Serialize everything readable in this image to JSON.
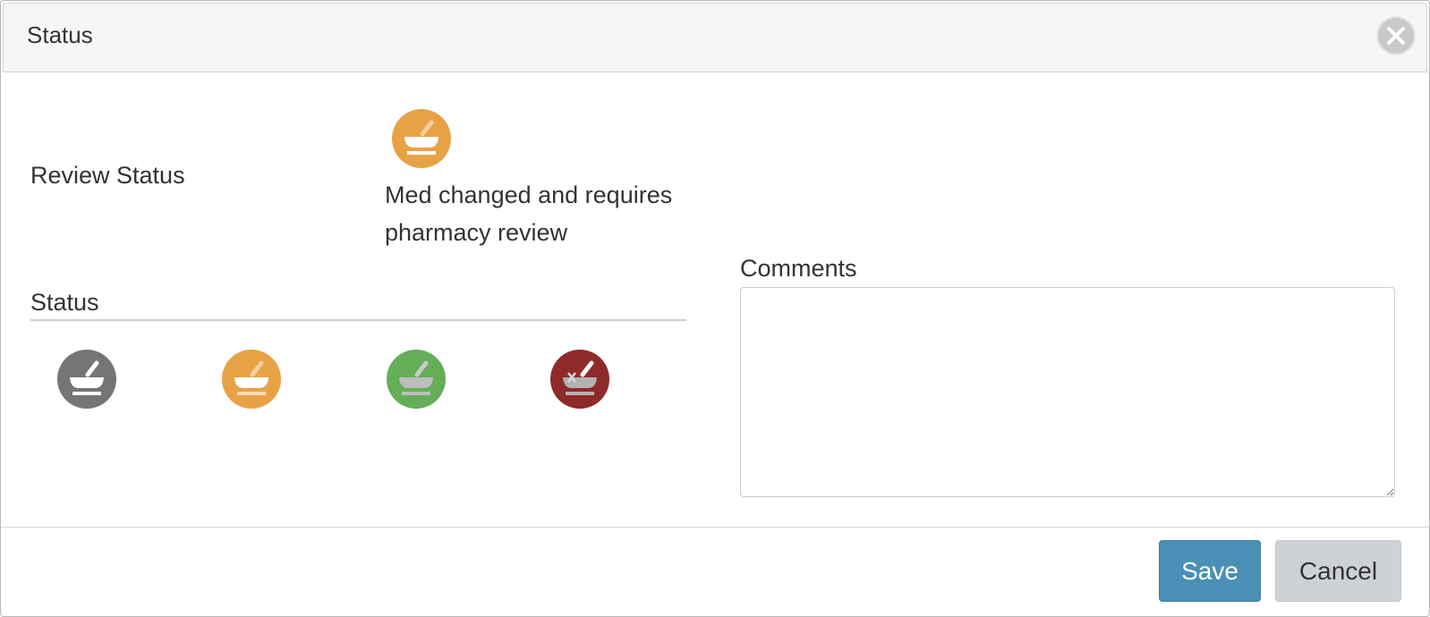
{
  "dialog": {
    "title": "Status"
  },
  "review": {
    "label": "Review Status",
    "current_status_text": "Med changed and requires pharmacy review",
    "current_status_icon": "mortar-pestle-pending-icon",
    "current_status_color": "#e8a246"
  },
  "status_group": {
    "legend": "Status",
    "options": [
      {
        "name": "status-option-unreviewed",
        "icon": "mortar-pestle-icon",
        "color": "#757575"
      },
      {
        "name": "status-option-pending",
        "icon": "mortar-pestle-icon",
        "color": "#e8a246"
      },
      {
        "name": "status-option-approved",
        "icon": "mortar-pestle-icon",
        "color": "#64ae58"
      },
      {
        "name": "status-option-rejected",
        "icon": "mortar-pestle-x-icon",
        "color": "#8e2a2a"
      }
    ]
  },
  "comments": {
    "label": "Comments",
    "value": "",
    "placeholder": ""
  },
  "footer": {
    "save_label": "Save",
    "cancel_label": "Cancel"
  },
  "colors": {
    "save_button": "#4a8fb5",
    "cancel_button": "#ced2d6",
    "titlebar": "#f6f6f6"
  }
}
